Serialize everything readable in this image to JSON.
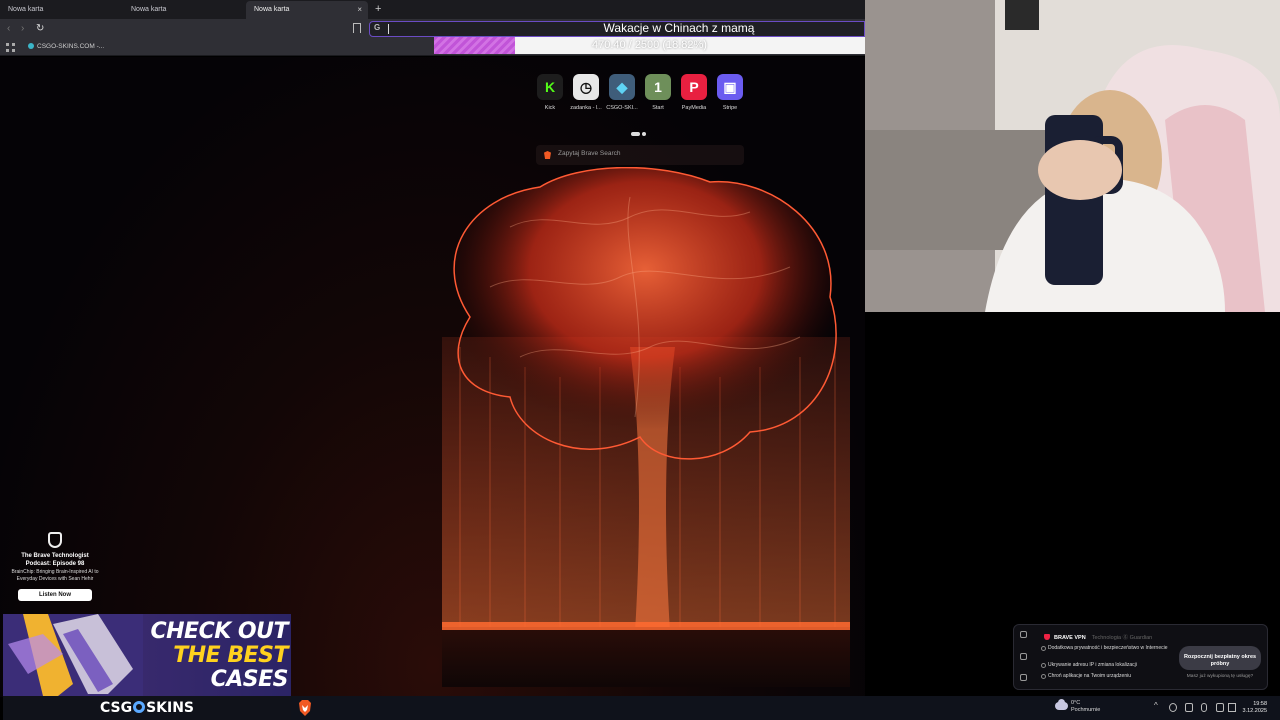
{
  "tabs": [
    "Nowa karta",
    "Nowa karta",
    "Nowa karta"
  ],
  "tab_close": "×",
  "new_tab": "+",
  "nav": {
    "back": "‹",
    "forward": "›",
    "reload": "↻"
  },
  "url": {
    "engine_glyph": "G",
    "value": ""
  },
  "bookmarks_bar": {
    "item": "CSGO-SKINS.COM -..."
  },
  "goal": {
    "title": "Wakacje w Chinach z mamą",
    "progress_text": "470.40 / 2500 (18.82%)",
    "current": 470.4,
    "target": 2500,
    "fraction": 0.1882,
    "fill_color": "#c154d8"
  },
  "ntp": {
    "tiles": [
      {
        "label": "Kick",
        "glyph": "K",
        "bg": "#1d1d1d",
        "fg": "#53fc18",
        "icon": "kick-icon"
      },
      {
        "label": "zadanka - l...",
        "glyph": "◷",
        "bg": "#e8e8e8",
        "fg": "#111111",
        "icon": "zadanka-icon"
      },
      {
        "label": "CSGO-SKI...",
        "glyph": "◆",
        "bg": "#3f5d7a",
        "fg": "#5fd3f3",
        "icon": "csgo-skins-icon"
      },
      {
        "label": "Start",
        "glyph": "1",
        "bg": "#6e8f5a",
        "fg": "#ffffff",
        "icon": "start-icon"
      },
      {
        "label": "PayMedia",
        "glyph": "P",
        "bg": "#e82040",
        "fg": "#ffffff",
        "icon": "paymedia-icon"
      },
      {
        "label": "Stripe",
        "glyph": "▣",
        "bg": "#6b5cf0",
        "fg": "#ffffff",
        "icon": "stripe-icon"
      }
    ],
    "search_placeholder": "Zapytaj Brave Search"
  },
  "promo": {
    "title": "The Brave Technologist Podcast: Episode 98",
    "subtitle": "BrainChip: Bringing Brain-Inspired AI to Everyday Devices with Sean Hehir",
    "button": "Listen Now"
  },
  "csgo_banner": {
    "line1": "CHECK OUT",
    "line2": "THE BEST",
    "line3": "CASES",
    "logo_left": "CSG",
    "logo_right": "SKINS"
  },
  "vpn": {
    "title": "BRAVE VPN",
    "tech": "Technologia ⓖ Guardian",
    "features": [
      "Dodatkowa prywatność i bezpieczeństwo w Internecie",
      "Ukrywanie adresu IP i zmiana lokalizacji",
      "Chroń aplikacje na Twoim urządzeniu"
    ],
    "cta": "Rozpocznij bezpłatny okres próbny",
    "already": "Masz już wykupioną tę usługę?"
  },
  "taskbar": {
    "weather_temp": "0°C",
    "weather_desc": "Pochmurnie",
    "time": "19:58",
    "date": "3.12.2025"
  }
}
